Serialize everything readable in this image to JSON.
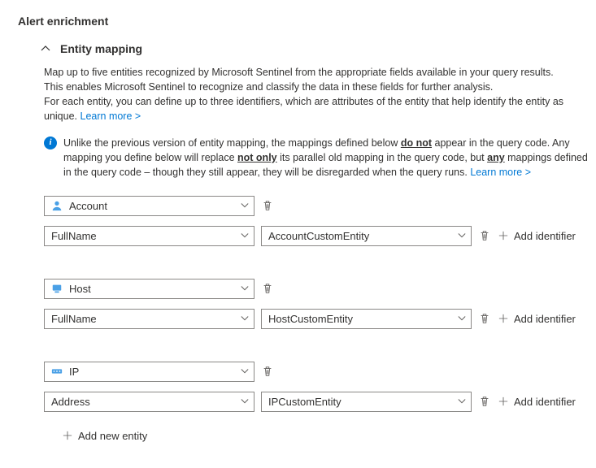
{
  "heading": "Alert enrichment",
  "section": {
    "title": "Entity mapping",
    "description": {
      "line1": "Map up to five entities recognized by Microsoft Sentinel from the appropriate fields available in your query results.",
      "line2": "This enables Microsoft Sentinel to recognize and classify the data in these fields for further analysis.",
      "line3": "For each entity, you can define up to three identifiers, which are attributes of the entity that help identify the entity as unique.",
      "learnMore": "Learn more >"
    },
    "info": {
      "part1": "Unlike the previous version of entity mapping, the mappings defined below ",
      "u1": "do not",
      "part2": " appear in the query code. Any mapping you define below will replace ",
      "u2": "not only",
      "part3": " its parallel old mapping in the query code, but ",
      "u3": "any",
      "part4": " mappings defined in the query code – though they still appear, they will be disregarded when the query runs. ",
      "learnMore": "Learn more >"
    }
  },
  "entities": [
    {
      "type": "Account",
      "identifier": "FullName",
      "value": "AccountCustomEntity"
    },
    {
      "type": "Host",
      "identifier": "FullName",
      "value": "HostCustomEntity"
    },
    {
      "type": "IP",
      "identifier": "Address",
      "value": "IPCustomEntity"
    }
  ],
  "labels": {
    "addIdentifier": "Add identifier",
    "addNewEntity": "Add new entity"
  }
}
